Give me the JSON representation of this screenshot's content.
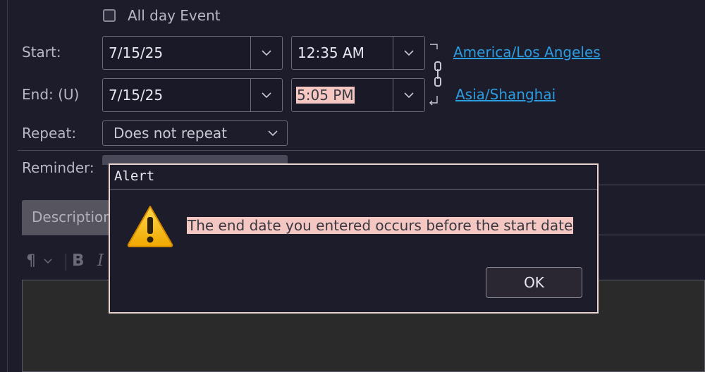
{
  "event": {
    "all_day_label": "All day Event",
    "start_label": "Start:",
    "start_date": "7/15/25",
    "start_time": "12:35 AM",
    "start_timezone": "America/Los Angeles",
    "end_label": "End: (U)",
    "end_date": "7/15/25",
    "end_time": "5:05 PM",
    "end_timezone": "Asia/Shanghai",
    "repeat_label": "Repeat:",
    "repeat_value": "Does not repeat",
    "reminder_label": "Reminder:",
    "description_tab": "Description"
  },
  "alert": {
    "title": "Alert",
    "message": "The end date you entered occurs before the start date",
    "ok_label": "OK",
    "icon": "warning-icon"
  },
  "colors": {
    "background": "#1d1c2b",
    "link": "#2c9ce0",
    "highlight": "#f4c7c3",
    "warning": "#f5b800"
  }
}
